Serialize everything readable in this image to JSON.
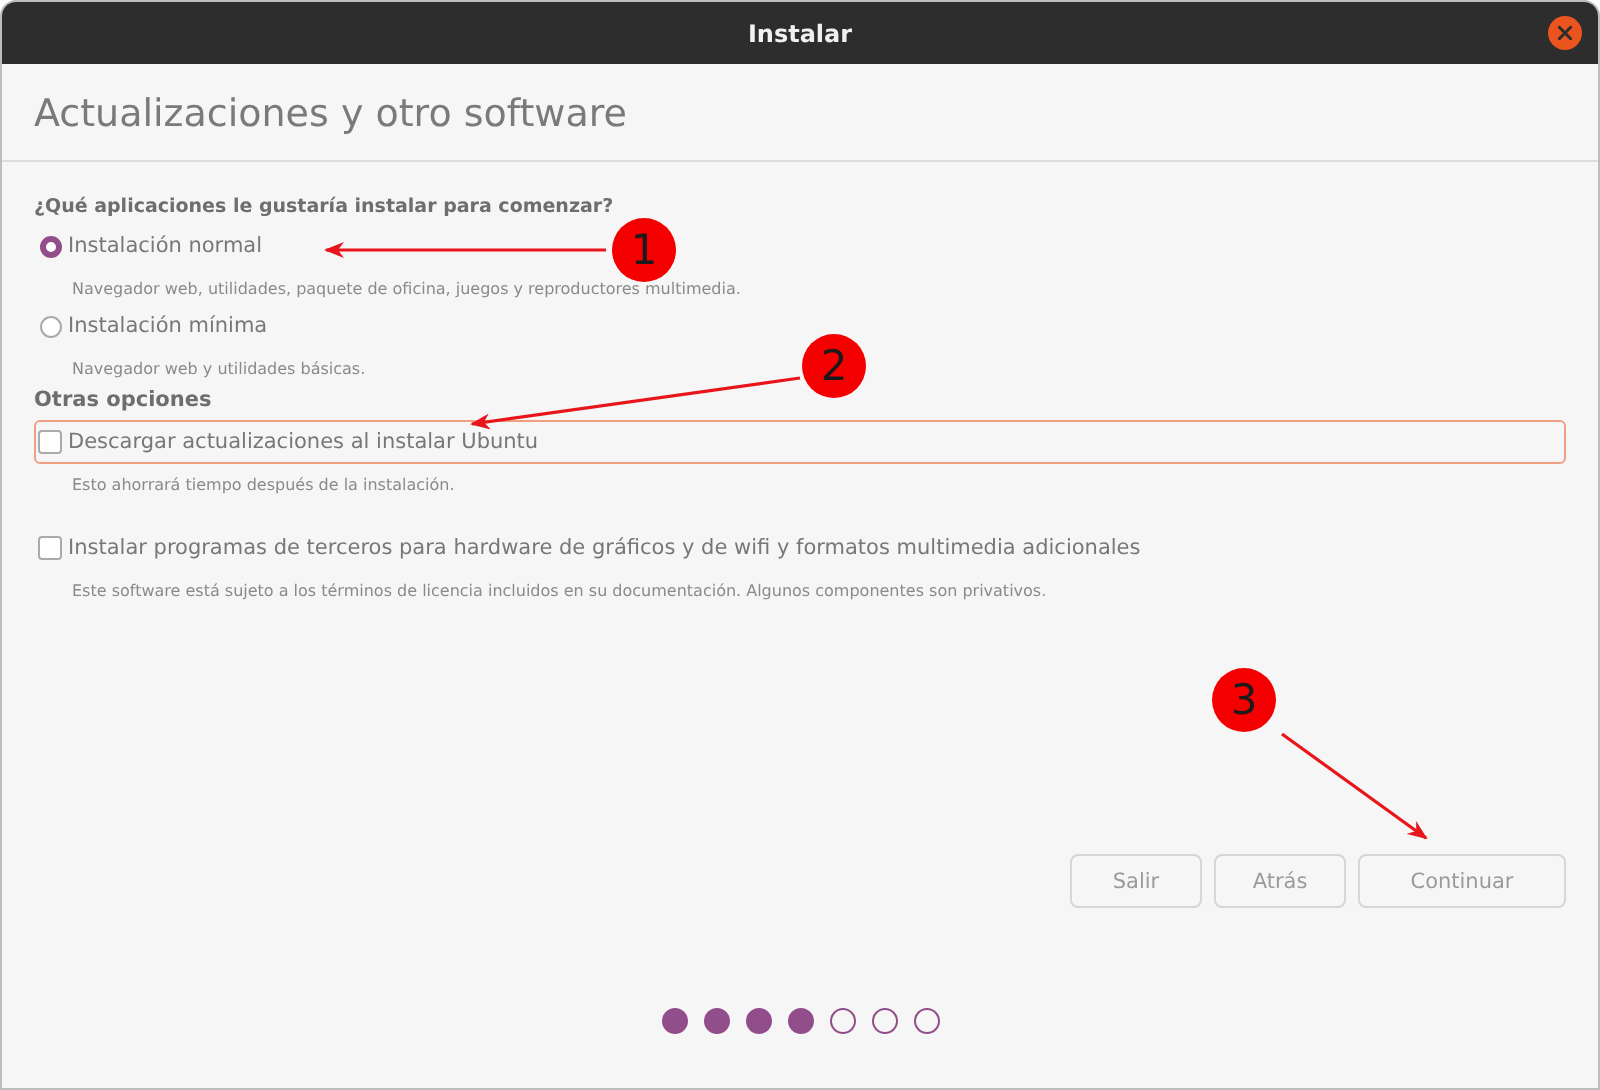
{
  "window": {
    "title": "Instalar"
  },
  "heading": "Actualizaciones y otro software",
  "question": "¿Qué aplicaciones le gustaría instalar para comenzar?",
  "install_types": [
    {
      "label": "Instalación normal",
      "description": "Navegador web, utilidades, paquete de oficina, juegos y reproductores multimedia.",
      "selected": true
    },
    {
      "label": "Instalación mínima",
      "description": "Navegador web y utilidades básicas.",
      "selected": false
    }
  ],
  "other_options_title": "Otras opciones",
  "options": [
    {
      "label": "Descargar actualizaciones al instalar Ubuntu",
      "description": "Esto ahorrará tiempo después de la instalación.",
      "checked": false,
      "focused": true
    },
    {
      "label": "Instalar programas de terceros para hardware de gráficos y de wifi y formatos multimedia adicionales",
      "description": "Este software está sujeto a los términos de licencia incluidos en su documentación. Algunos componentes son privativos.",
      "checked": false,
      "focused": false
    }
  ],
  "buttons": [
    "Salir",
    "Atrás",
    "Continuar"
  ],
  "steps": [
    {
      "done": true
    },
    {
      "done": true
    },
    {
      "done": true
    },
    {
      "done": true
    },
    {
      "done": false
    },
    {
      "done": false
    },
    {
      "done": false
    }
  ],
  "annotations": [
    {
      "label": "1"
    },
    {
      "label": "2"
    },
    {
      "label": "3"
    }
  ]
}
